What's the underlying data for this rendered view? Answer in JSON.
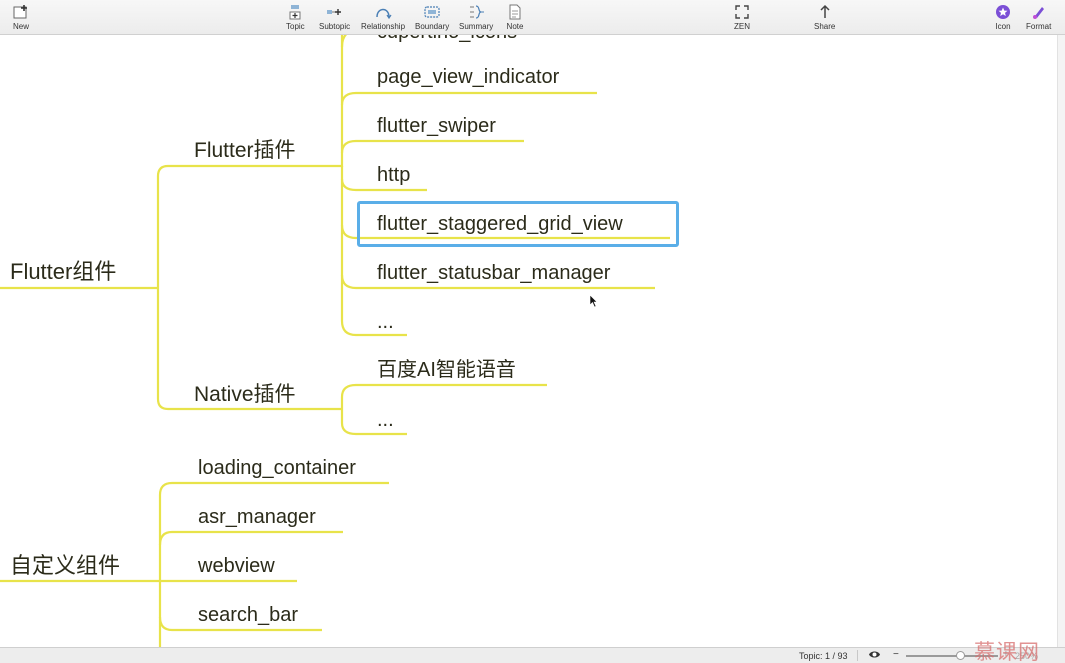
{
  "toolbar": {
    "new": "New",
    "topic": "Topic",
    "subtopic": "Subtopic",
    "relationship": "Relationship",
    "boundary": "Boundary",
    "summary": "Summary",
    "note": "Note",
    "zen": "ZEN",
    "share": "Share",
    "icon": "Icon",
    "format": "Format"
  },
  "mindmap": {
    "branch1": {
      "label": "Flutter组件",
      "sub1": {
        "label": "Flutter插件",
        "leaves": [
          "cupertino_icons",
          "page_view_indicator",
          "flutter_swiper",
          "http",
          "flutter_staggered_grid_view",
          "flutter_statusbar_manager",
          "..."
        ]
      },
      "sub2": {
        "label": "Native插件",
        "leaves": [
          "百度AI智能语音",
          "..."
        ]
      }
    },
    "branch2": {
      "label": "自定义组件",
      "leaves": [
        "loading_container",
        "asr_manager",
        "webview",
        "search_bar"
      ]
    },
    "selected": "flutter_staggered_grid_view",
    "line_color": "#e8e34a",
    "selection_color": "#5aaee8"
  },
  "status": {
    "topic": "Topic: 1 / 93",
    "zoom_minus": "−",
    "zoom_plus": "+",
    "zoom": "250%"
  },
  "watermark": "慕课网"
}
